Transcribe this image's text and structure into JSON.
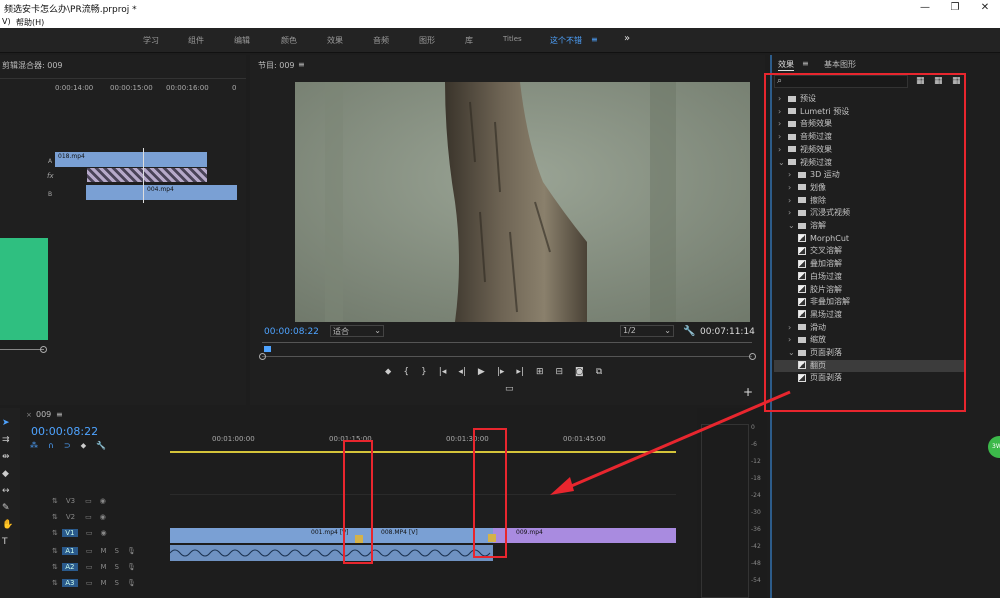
{
  "titlebar": {
    "title": "频选安卡怎么办\\PR流畅.prproj *"
  },
  "menubar": {
    "items": [
      "V)",
      "帮助(H)"
    ]
  },
  "workspaces": {
    "tabs": [
      "学习",
      "组件",
      "编辑",
      "颜色",
      "效果",
      "音频",
      "图形",
      "库",
      "Titles",
      "这个不错"
    ],
    "menu_icon": "≡",
    "more": "»"
  },
  "source": {
    "header": "剪辑混合器: 009",
    "times": [
      "0:00:14:00",
      "00:00:15:00",
      "00:00:16:00",
      "0"
    ],
    "tracks": [
      "A",
      "fx",
      "B"
    ],
    "clips": [
      "018.mp4",
      "004.mp4"
    ]
  },
  "program": {
    "header": "节目: 009",
    "menu_icon": "≡",
    "timecode": "00:00:08:22",
    "fit_label": "适合",
    "quality": "1/2",
    "duration": "00:07:11:14"
  },
  "effects": {
    "tabs": [
      "效果",
      "基本图形"
    ],
    "menu_icon": "≡",
    "search_placeholder": "",
    "tree": [
      {
        "label": "预设",
        "level": 0,
        "type": "folder-special",
        "exp": "›"
      },
      {
        "label": "Lumetri 预设",
        "level": 0,
        "type": "folder-special",
        "exp": "›"
      },
      {
        "label": "音频效果",
        "level": 0,
        "type": "folder",
        "exp": "›"
      },
      {
        "label": "音频过渡",
        "level": 0,
        "type": "folder",
        "exp": "›"
      },
      {
        "label": "视频效果",
        "level": 0,
        "type": "folder",
        "exp": "›"
      },
      {
        "label": "视频过渡",
        "level": 0,
        "type": "folder",
        "exp": "⌄"
      },
      {
        "label": "3D 运动",
        "level": 1,
        "type": "folder",
        "exp": "›"
      },
      {
        "label": "划像",
        "level": 1,
        "type": "folder",
        "exp": "›"
      },
      {
        "label": "擦除",
        "level": 1,
        "type": "folder",
        "exp": "›"
      },
      {
        "label": "沉浸式视频",
        "level": 1,
        "type": "folder",
        "exp": "›"
      },
      {
        "label": "溶解",
        "level": 1,
        "type": "folder",
        "exp": "⌄"
      },
      {
        "label": "MorphCut",
        "level": 2,
        "type": "fx"
      },
      {
        "label": "交叉溶解",
        "level": 2,
        "type": "fx"
      },
      {
        "label": "叠加溶解",
        "level": 2,
        "type": "fx"
      },
      {
        "label": "白场过渡",
        "level": 2,
        "type": "fx"
      },
      {
        "label": "胶片溶解",
        "level": 2,
        "type": "fx"
      },
      {
        "label": "非叠加溶解",
        "level": 2,
        "type": "fx"
      },
      {
        "label": "黑场过渡",
        "level": 2,
        "type": "fx"
      },
      {
        "label": "滑动",
        "level": 1,
        "type": "folder",
        "exp": "›"
      },
      {
        "label": "缩放",
        "level": 1,
        "type": "folder",
        "exp": "›"
      },
      {
        "label": "页面剥落",
        "level": 1,
        "type": "folder",
        "exp": "⌄"
      },
      {
        "label": "翻页",
        "level": 2,
        "type": "fx",
        "selected": true
      },
      {
        "label": "页面剥落",
        "level": 2,
        "type": "fx"
      }
    ]
  },
  "timeline": {
    "header": "009",
    "menu_icon": "≡",
    "timecode": "00:00:08:22",
    "ruler": [
      "00:01:00:00",
      "00:01:15:00",
      "00:01:30:00",
      "00:01:45:00"
    ],
    "tracks": [
      "V3",
      "V2",
      "V1",
      "A1",
      "A2",
      "A3"
    ],
    "clips": [
      "001.mp4 [V]",
      "008.MP4 [V]",
      "009.mp4"
    ]
  },
  "meter": {
    "labels": [
      "0",
      "-6",
      "-12",
      "-18",
      "-24",
      "-30",
      "-36",
      "-42",
      "-48",
      "-54"
    ]
  },
  "colors": {
    "accent": "#4ea3ff",
    "annotation": "#e8262e",
    "clip_blue": "#7aa0d4",
    "clip_purple": "#a98be0",
    "green": "#2fbf80"
  }
}
